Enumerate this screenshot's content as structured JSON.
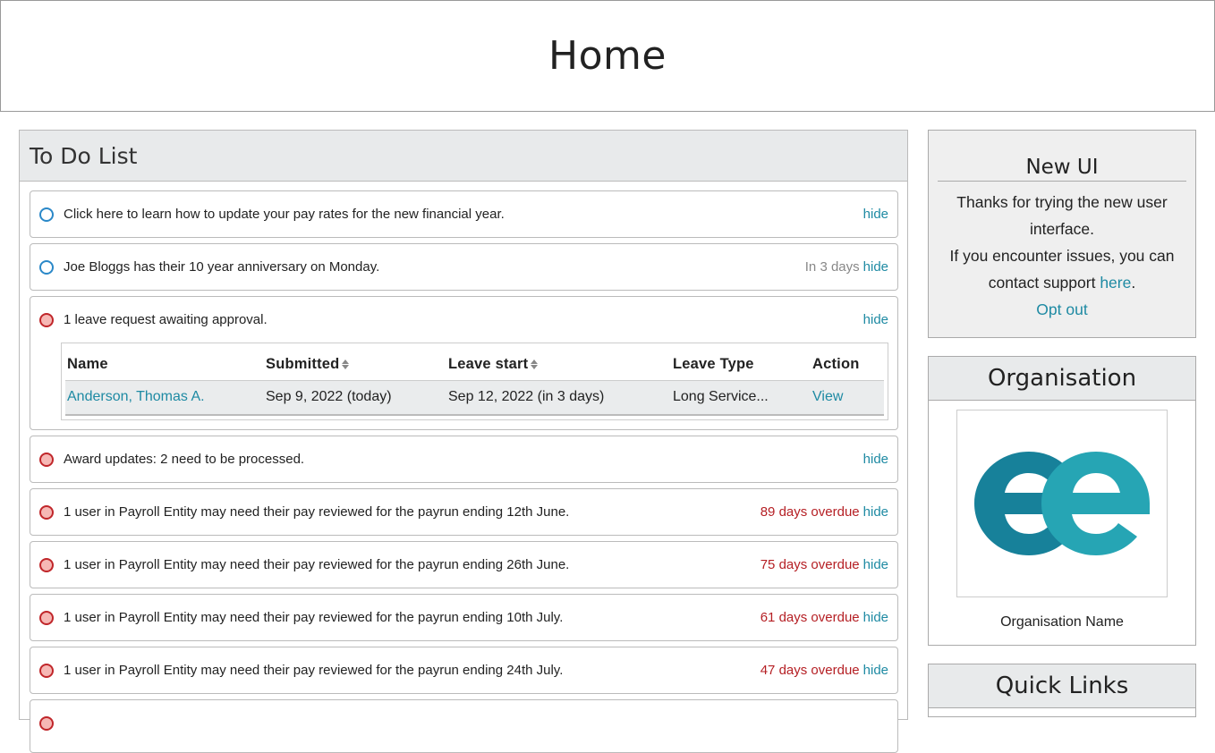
{
  "header": {
    "title": "Home"
  },
  "todo": {
    "title": "To Do List",
    "hide_label": "hide",
    "items": [
      {
        "status": "blue",
        "text": "Click here to learn how to update your pay rates for the new financial year.",
        "note": "",
        "note_type": ""
      },
      {
        "status": "blue",
        "text": "Joe Bloggs has their 10 year anniversary on Monday.",
        "note": "In 3 days",
        "note_type": "due"
      },
      {
        "status": "red",
        "text": "1 leave request awaiting approval.",
        "note": "",
        "note_type": ""
      },
      {
        "status": "red",
        "text": "Award updates: 2 need to be processed.",
        "note": "",
        "note_type": ""
      },
      {
        "status": "red",
        "text": "1 user in Payroll Entity may need their pay reviewed for the payrun ending 12th June.",
        "note": "89 days overdue",
        "note_type": "overdue"
      },
      {
        "status": "red",
        "text": "1 user in Payroll Entity may need their pay reviewed for the payrun ending 26th June.",
        "note": "75 days overdue",
        "note_type": "overdue"
      },
      {
        "status": "red",
        "text": "1 user in Payroll Entity may need their pay reviewed for the payrun ending 10th July.",
        "note": "61 days overdue",
        "note_type": "overdue"
      },
      {
        "status": "red",
        "text": "1 user in Payroll Entity may need their pay reviewed for the payrun ending 24th July.",
        "note": "47 days overdue",
        "note_type": "overdue"
      }
    ],
    "leave_table": {
      "headers": {
        "name": "Name",
        "submitted": "Submitted",
        "leave_start": "Leave start",
        "leave_type": "Leave Type",
        "action": "Action"
      },
      "row": {
        "name": "Anderson, Thomas A.",
        "submitted": "Sep 9, 2022 (today)",
        "leave_start": "Sep 12, 2022 (in 3 days)",
        "leave_type": "Long Service...",
        "action": "View"
      }
    }
  },
  "new_ui": {
    "title": "New UI",
    "line1": "Thanks for trying the new user interface.",
    "line2": "If you encounter issues, you can contact support",
    "support_link": "here",
    "line2_end": ".",
    "opt_out": "Opt out"
  },
  "organisation": {
    "title": "Organisation",
    "name": "Organisation Name",
    "logo": "ee-logo"
  },
  "quick_links": {
    "title": "Quick Links"
  },
  "colors": {
    "link": "#1e8aa3",
    "overdue": "#b51f24",
    "blue_status": "#2a88c8",
    "red_status": "#c0262a",
    "logo_dark": "#17819a",
    "logo_light": "#26a5b4"
  }
}
